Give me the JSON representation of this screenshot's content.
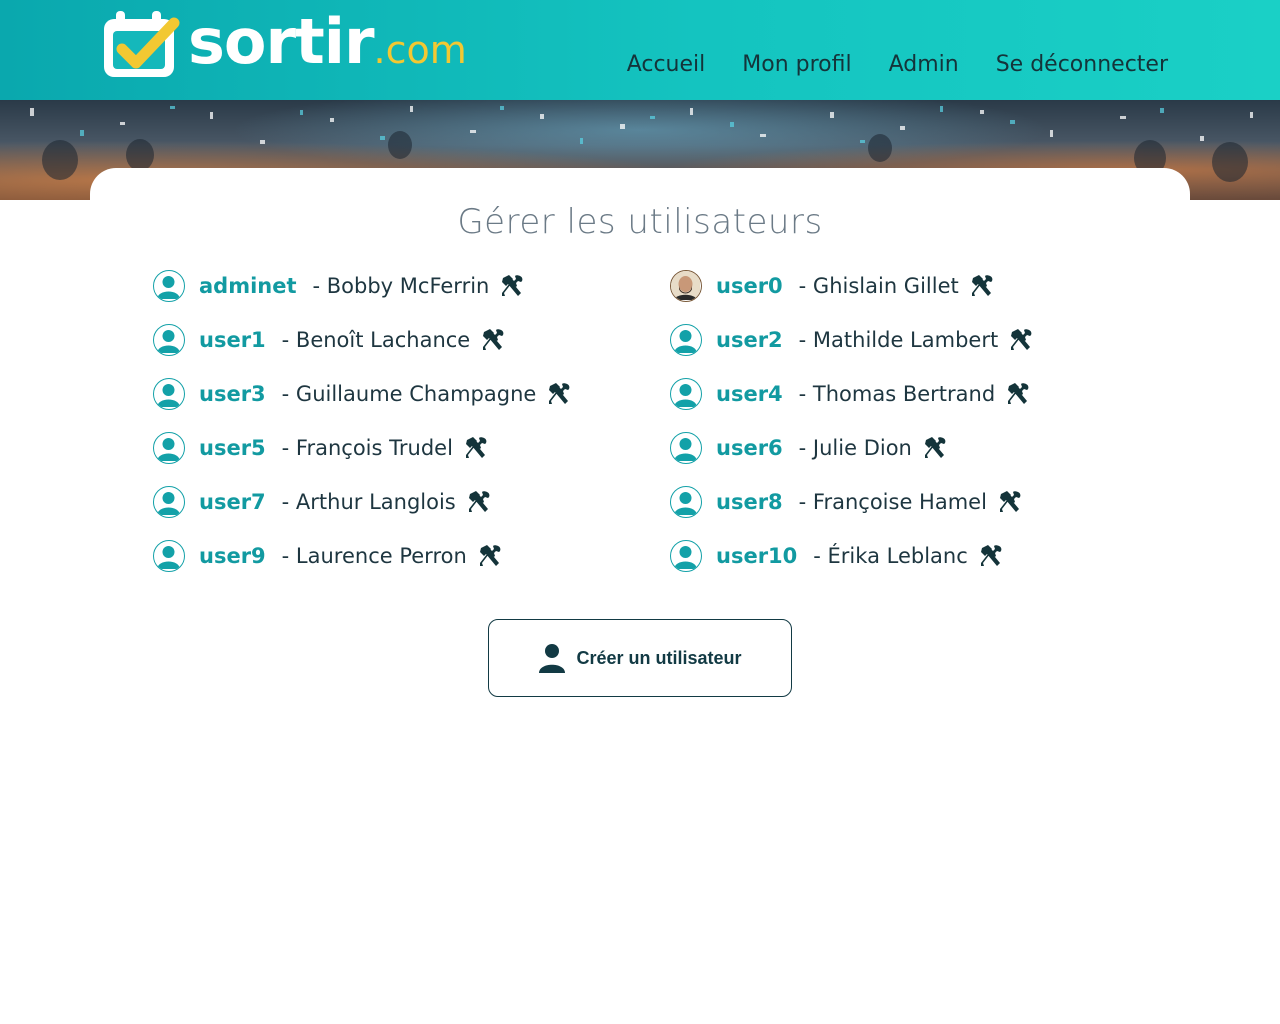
{
  "header": {
    "logo_main": "sortir",
    "logo_suffix": ".com",
    "nav": [
      {
        "label": "Accueil"
      },
      {
        "label": "Mon profil"
      },
      {
        "label": "Admin"
      },
      {
        "label": "Se déconnecter"
      }
    ]
  },
  "main": {
    "title": "Gérer les utilisateurs",
    "users": [
      {
        "username": "adminet",
        "fullname": "- Bobby McFerrin",
        "avatar": "default-avatar-icon",
        "action_icon": "hammer-wrench-icon"
      },
      {
        "username": "user0",
        "fullname": "- Ghislain Gillet",
        "avatar": "photo-avatar",
        "action_icon": "hammer-wrench-icon"
      },
      {
        "username": "user1",
        "fullname": "- Benoît Lachance",
        "avatar": "default-avatar-icon",
        "action_icon": "hammer-wrench-icon"
      },
      {
        "username": "user2",
        "fullname": "- Mathilde Lambert",
        "avatar": "default-avatar-icon",
        "action_icon": "hammer-wrench-icon"
      },
      {
        "username": "user3",
        "fullname": "- Guillaume Champagne",
        "avatar": "default-avatar-icon",
        "action_icon": "hammer-wrench-icon"
      },
      {
        "username": "user4",
        "fullname": "- Thomas Bertrand",
        "avatar": "default-avatar-icon",
        "action_icon": "hammer-wrench-icon"
      },
      {
        "username": "user5",
        "fullname": "- François Trudel",
        "avatar": "default-avatar-icon",
        "action_icon": "hammer-wrench-icon"
      },
      {
        "username": "user6",
        "fullname": "- Julie Dion",
        "avatar": "default-avatar-icon",
        "action_icon": "hammer-wrench-icon"
      },
      {
        "username": "user7",
        "fullname": "- Arthur Langlois",
        "avatar": "default-avatar-icon",
        "action_icon": "hammer-wrench-icon"
      },
      {
        "username": "user8",
        "fullname": "- Françoise Hamel",
        "avatar": "default-avatar-icon",
        "action_icon": "hammer-wrench-icon"
      },
      {
        "username": "user9",
        "fullname": "- Laurence Perron",
        "avatar": "default-avatar-icon",
        "action_icon": "hammer-wrench-icon"
      },
      {
        "username": "user10",
        "fullname": "- Érika Leblanc",
        "avatar": "default-avatar-icon",
        "action_icon": "hammer-wrench-icon"
      }
    ],
    "create_button": {
      "label": "Créer un utilisateur",
      "icon": "user-icon"
    }
  },
  "colors": {
    "header_start": "#0aa8ae",
    "header_end": "#1ad0c6",
    "accent": "#129aa1",
    "logo_suffix": "#f2c832",
    "text_dark": "#1e3640"
  }
}
